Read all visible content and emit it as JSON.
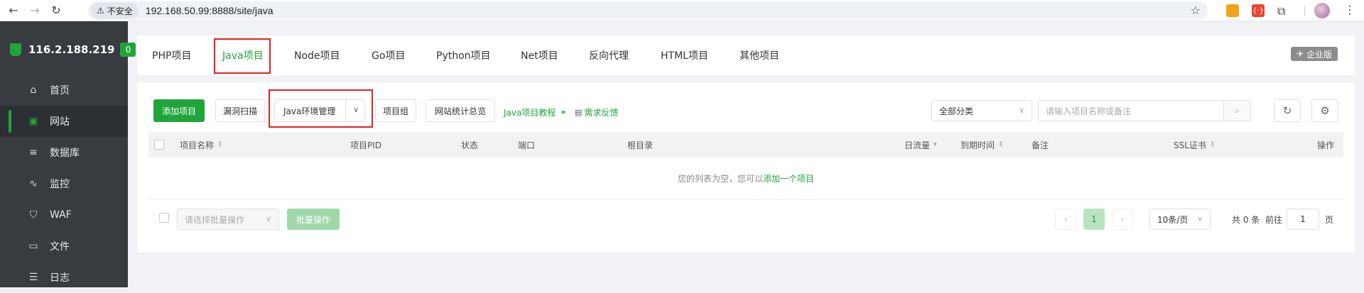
{
  "browser": {
    "insecure_label": "不安全",
    "url": "192.168.50.99:8888/site/java"
  },
  "sidebar": {
    "server_name": "116.2.188.219",
    "server_badge": "0",
    "items": [
      {
        "label": "首页",
        "icon": "home-icon"
      },
      {
        "label": "网站",
        "icon": "globe-icon"
      },
      {
        "label": "数据库",
        "icon": "database-icon"
      },
      {
        "label": "监控",
        "icon": "monitor-icon"
      },
      {
        "label": "WAF",
        "icon": "shield-icon"
      },
      {
        "label": "文件",
        "icon": "folder-icon"
      },
      {
        "label": "日志",
        "icon": "log-icon"
      }
    ]
  },
  "tabs": {
    "items": [
      "PHP项目",
      "Java项目",
      "Node项目",
      "Go项目",
      "Python项目",
      "Net项目",
      "反向代理",
      "HTML项目",
      "其他项目"
    ],
    "active": "Java项目",
    "enterprise": "企业版"
  },
  "toolbar": {
    "add": "添加项目",
    "scan": "漏洞扫描",
    "env": "Java环境管理",
    "group": "项目组",
    "stats": "网站统计总览",
    "tutorial": "Java项目教程",
    "feedback": "需求反馈",
    "category": "全部分类",
    "search_placeholder": "请输入项目名称或备注"
  },
  "table": {
    "columns": [
      "项目名称",
      "项目PID",
      "状态",
      "端口",
      "根目录",
      "日流量",
      "到期时间",
      "备注",
      "SSL证书",
      "操作"
    ],
    "empty_text": "您的列表为空，您可以",
    "empty_link": "添加一个项目"
  },
  "footer": {
    "batch_placeholder": "请选择批量操作",
    "batch_btn": "批量操作",
    "current_page": "1",
    "page_size": "10条/页",
    "total": "共 0 条",
    "goto": "前往",
    "goto_value": "1",
    "page_unit": "页"
  },
  "colors": {
    "accent": "#20a53a",
    "sidebar": "#383b40",
    "highlight": "#e02020"
  }
}
